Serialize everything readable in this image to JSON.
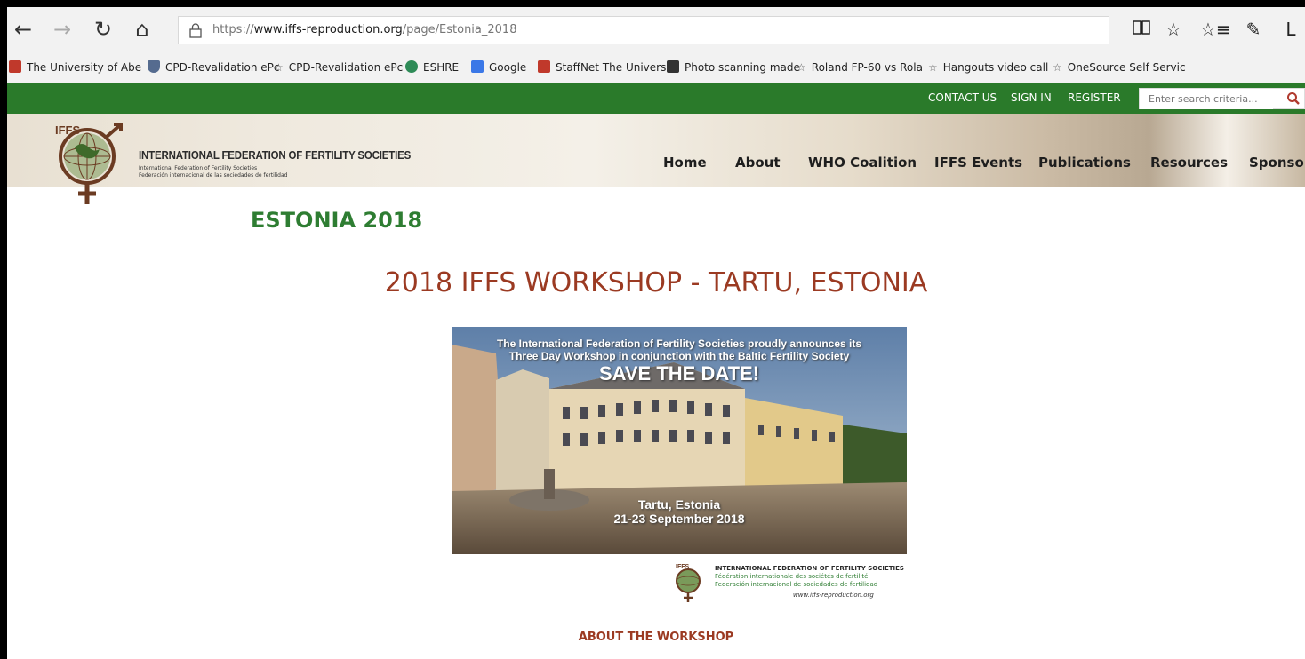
{
  "browser": {
    "url_prefix": "https://",
    "url_host": "www.iffs-reproduction.org",
    "url_path": "/page/Estonia_2018",
    "back": "←",
    "forward": "→",
    "refresh": "↻",
    "home": "⌂",
    "reading_view": "📖",
    "favorite_star": "☆",
    "favorites_hub": "☆≡",
    "notes": "✎",
    "more": "L"
  },
  "favorites": [
    {
      "label": "The University of Abe",
      "icon": "university-icon",
      "color": "#c0392b"
    },
    {
      "label": "CPD-Revalidation ePc",
      "icon": "shield-icon",
      "color": "#556b8f"
    },
    {
      "label": "CPD-Revalidation ePc",
      "icon": "star-icon",
      "color": "#666666"
    },
    {
      "label": "ESHRE",
      "icon": "eshre-icon",
      "color": "#2e8b57"
    },
    {
      "label": "Google",
      "icon": "google-icon",
      "color": "#3b78e7"
    },
    {
      "label": "StaffNet The Univers",
      "icon": "university-icon",
      "color": "#c0392b"
    },
    {
      "label": "Photo scanning made",
      "icon": "photo-icon",
      "color": "#333333"
    },
    {
      "label": "Roland FP-60 vs Rola",
      "icon": "star-icon",
      "color": "#666666"
    },
    {
      "label": "Hangouts video call",
      "icon": "star-icon",
      "color": "#666666"
    },
    {
      "label": "OneSource Self Servic",
      "icon": "star-icon",
      "color": "#666666"
    }
  ],
  "topbar": {
    "contact": "CONTACT US",
    "signin": "SIGN IN",
    "register": "REGISTER",
    "search_placeholder": "Enter search criteria..."
  },
  "logo": {
    "letters": "IFFS",
    "title": "INTERNATIONAL FEDERATION OF FERTILITY SOCIETIES",
    "sub1": "International Federation of Fertility Societies",
    "sub2": "Federación internacional de las sociedades de fertilidad"
  },
  "nav": [
    "Home",
    "About",
    "WHO Coalition",
    "IFFS Events",
    "Publications",
    "Resources",
    "Sponsors"
  ],
  "page": {
    "title": "ESTONIA 2018",
    "heading": "2018 IFFS WORKSHOP - TARTU, ESTONIA",
    "about": "ABOUT THE WORKSHOP"
  },
  "banner": {
    "line1": "The International Federation of Fertility Societies proudly announces its",
    "line2": "Three Day Workshop in conjunction with the Baltic Fertility Society",
    "save": "SAVE THE DATE!",
    "place": "Tartu, Estonia",
    "dates": "21-23 September 2018"
  },
  "footer_logo": {
    "letters": "IFFS",
    "l1": "INTERNATIONAL FEDERATION OF FERTILITY SOCIETIES",
    "l2": "Fédération internationale des sociétés de fertilité",
    "l3": "Federación internacional de sociedades de fertilidad",
    "l4": "www.iffs-reproduction.org"
  },
  "colors": {
    "green": "#2a7a2a",
    "title_green": "#2e7d32",
    "heading_red": "#9b3a22"
  }
}
